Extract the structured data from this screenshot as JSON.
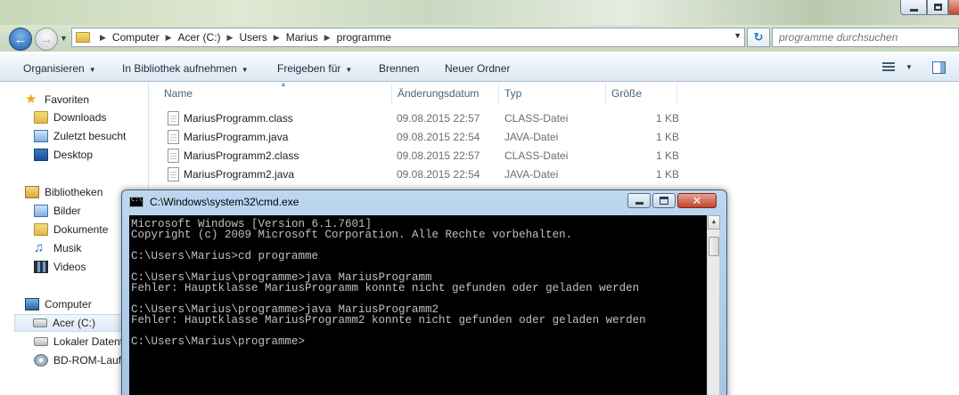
{
  "explorer": {
    "window_controls": [
      "minimize",
      "maximize",
      "close"
    ],
    "address": {
      "crumbs": [
        "Computer",
        "Acer (C:)",
        "Users",
        "Marius",
        "programme"
      ]
    },
    "search": {
      "placeholder": "programme durchsuchen"
    },
    "toolbar": {
      "organize": "Organisieren",
      "library": "In Bibliothek aufnehmen",
      "share": "Freigeben für",
      "burn": "Brennen",
      "new_folder": "Neuer Ordner"
    },
    "sidebar": {
      "favorites": "Favoriten",
      "downloads": "Downloads",
      "recent": "Zuletzt besucht",
      "desktop": "Desktop",
      "libraries": "Bibliotheken",
      "pictures": "Bilder",
      "documents": "Dokumente",
      "music": "Musik",
      "videos": "Videos",
      "computer": "Computer",
      "drive_c": "Acer (C:)",
      "drive_local": "Lokaler Datentr",
      "drive_bd": "BD-ROM-Laufw"
    },
    "columns": {
      "name": "Name",
      "date": "Änderungsdatum",
      "type": "Typ",
      "size": "Größe"
    },
    "files": [
      {
        "name": "MariusProgramm.class",
        "date": "09.08.2015 22:57",
        "type": "CLASS-Datei",
        "size": "1 KB"
      },
      {
        "name": "MariusProgramm.java",
        "date": "09.08.2015 22:54",
        "type": "JAVA-Datei",
        "size": "1 KB"
      },
      {
        "name": "MariusProgramm2.class",
        "date": "09.08.2015 22:57",
        "type": "CLASS-Datei",
        "size": "1 KB"
      },
      {
        "name": "MariusProgramm2.java",
        "date": "09.08.2015 22:54",
        "type": "JAVA-Datei",
        "size": "1 KB"
      }
    ]
  },
  "cmd": {
    "title": "C:\\Windows\\system32\\cmd.exe",
    "lines": [
      "Microsoft Windows [Version 6.1.7601]",
      "Copyright (c) 2009 Microsoft Corporation. Alle Rechte vorbehalten.",
      "",
      "C:\\Users\\Marius>cd programme",
      "",
      "C:\\Users\\Marius\\programme>java MariusProgramm",
      "Fehler: Hauptklasse MariusProgramm konnte nicht gefunden oder geladen werden",
      "",
      "C:\\Users\\Marius\\programme>java MariusProgramm2",
      "Fehler: Hauptklasse MariusProgramm2 konnte nicht gefunden oder geladen werden",
      "",
      "C:\\Users\\Marius\\programme>"
    ]
  },
  "colors": {
    "accent": "#1d5ea8",
    "console_bg": "#000000",
    "console_text": "#c0c0c0",
    "muted_text": "#6d6d6d"
  }
}
